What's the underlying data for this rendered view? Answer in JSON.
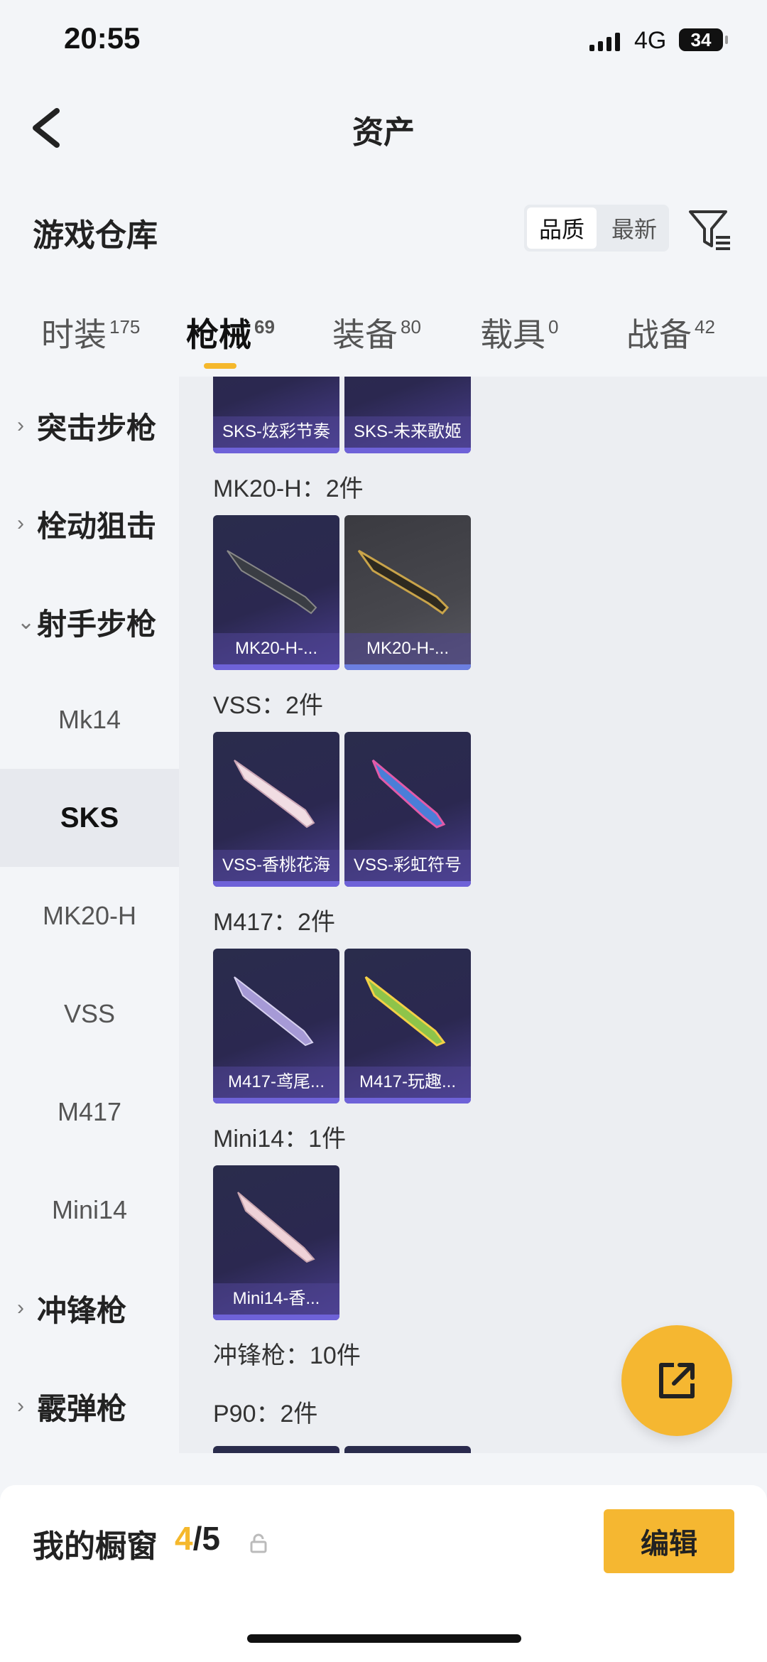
{
  "status": {
    "time": "20:55",
    "network": "4G",
    "battery": "34"
  },
  "nav": {
    "title": "资产"
  },
  "warehouse": {
    "title": "游戏仓库",
    "sort_quality": "品质",
    "sort_latest": "最新"
  },
  "tabs": [
    {
      "label": "时装",
      "count": "175"
    },
    {
      "label": "枪械",
      "count": "69"
    },
    {
      "label": "装备",
      "count": "80"
    },
    {
      "label": "载具",
      "count": "0"
    },
    {
      "label": "战备",
      "count": "42"
    }
  ],
  "sidebar": {
    "categories": [
      "突击步枪",
      "栓动狙击",
      "射手步枪",
      "冲锋枪",
      "霰弹枪"
    ],
    "subitems": [
      "Mk14",
      "SKS",
      "MK20-H",
      "VSS",
      "M417",
      "Mini14"
    ]
  },
  "content": {
    "top_cards": [
      "SKS-炫彩节奏",
      "SKS-未来歌姬"
    ],
    "groups": [
      {
        "title": "MK20-H：2件",
        "items": [
          "MK20-H-...",
          "MK20-H-..."
        ]
      },
      {
        "title": "VSS：2件",
        "items": [
          "VSS-香桃花海",
          "VSS-彩虹符号"
        ]
      },
      {
        "title": "M417：2件",
        "items": [
          "M417-鸢尾...",
          "M417-玩趣..."
        ]
      },
      {
        "title": "Mini14：1件",
        "items": [
          "Mini14-香..."
        ]
      }
    ],
    "smg_title": "冲锋枪：10件",
    "p90_title": "P90：2件"
  },
  "bottom": {
    "title": "我的橱窗",
    "current": "4",
    "total": "/5",
    "edit_label": "编辑"
  },
  "colors": {
    "accent": "#f5b731",
    "card_bg": "#2b2850",
    "card_bar": "#6e62d8"
  }
}
